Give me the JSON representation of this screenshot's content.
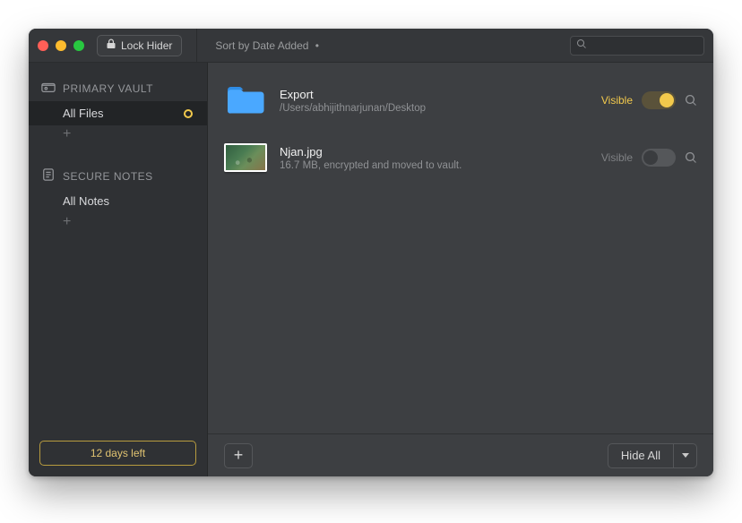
{
  "titlebar": {
    "lock_label": "Lock Hider",
    "sort_label": "Sort by Date Added",
    "search_placeholder": ""
  },
  "sidebar": {
    "sections": [
      {
        "title": "PRIMARY VAULT",
        "items": [
          {
            "label": "All Files",
            "selected": true,
            "badge": "ring"
          }
        ]
      },
      {
        "title": "SECURE NOTES",
        "items": [
          {
            "label": "All Notes",
            "selected": false
          }
        ]
      }
    ],
    "days_left_label": "12 days left"
  },
  "main": {
    "rows": [
      {
        "kind": "folder",
        "title": "Export",
        "subtitle": "/Users/abhijithnarjunan/Desktop",
        "visibility_label": "Visible",
        "visible": true
      },
      {
        "kind": "image",
        "title": "Njan.jpg",
        "subtitle": "16.7 MB, encrypted and moved to vault.",
        "visibility_label": "Visible",
        "visible": false
      }
    ],
    "footer": {
      "hide_all_label": "Hide All"
    }
  },
  "colors": {
    "accent": "#f2c94c",
    "bg": "#3d3f42",
    "sidebar": "#2f3134"
  }
}
